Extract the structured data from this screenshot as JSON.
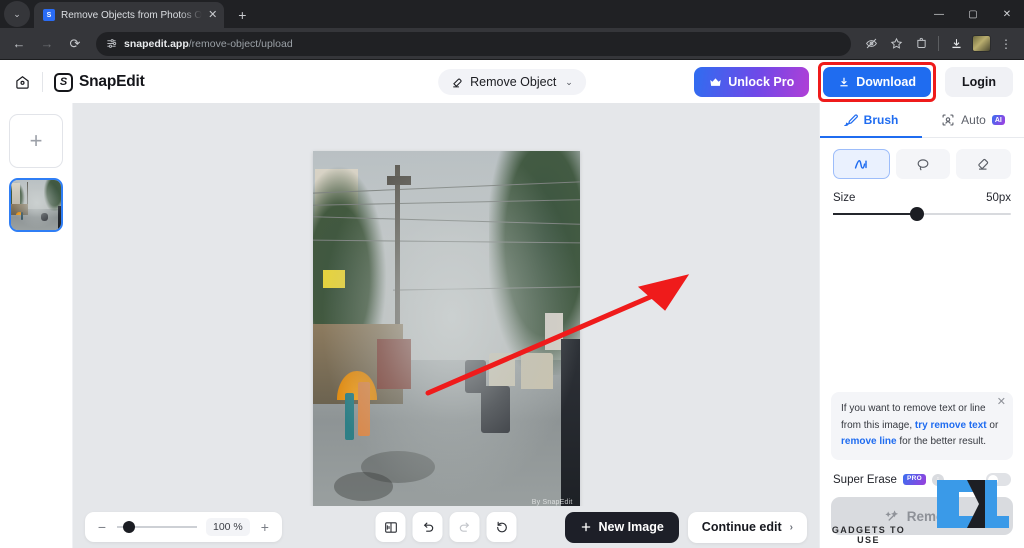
{
  "browser": {
    "tab": {
      "title": "Remove Objects from Photos O",
      "favicon": "S",
      "close_icon": "✕"
    },
    "new_tab_icon": "+",
    "tab_list_icon": "⌄",
    "window": {
      "minimize": "—",
      "maximize": "▢",
      "close": "✕"
    },
    "nav": {
      "back": "←",
      "forward": "→",
      "reload": "⟳"
    },
    "url": {
      "domain": "snapedit.app",
      "path": "/remove-object/upload",
      "site_icon": "site-settings"
    },
    "toolbar_icons": [
      "eye-slash-icon",
      "star-icon",
      "extensions-icon",
      "downloads-icon",
      "profile-avatar",
      "menu-icon"
    ]
  },
  "appbar": {
    "home_icon": "home",
    "brand_mark": "S",
    "brand_name": "SnapEdit",
    "mode": {
      "label": "Remove Object",
      "icon": "eraser-icon",
      "chevron": "⌄"
    },
    "unlock_pro": "Unlock Pro",
    "download": "Download",
    "login": "Login",
    "highlight_color": "#ef1b1b",
    "download_color": "#1f6cf0"
  },
  "sidebar": {
    "add_label": "+",
    "thumbnail_alt": "rainy street scene thumbnail"
  },
  "canvas": {
    "watermark": "By SnapEdit"
  },
  "panel": {
    "tabs": [
      {
        "label": "Brush",
        "icon": "brush-icon",
        "active": true
      },
      {
        "label": "Auto",
        "icon": "auto-select-icon",
        "badge": "AI",
        "active": false
      }
    ],
    "tools": [
      {
        "name": "brush-tool",
        "icon": "brush-stroke",
        "active": true
      },
      {
        "name": "lasso-tool",
        "icon": "lasso",
        "active": false
      },
      {
        "name": "eraser-tool",
        "icon": "eraser",
        "active": false
      }
    ],
    "size": {
      "label": "Size",
      "value": "50px",
      "percent": 50
    },
    "info": {
      "text_before": "If you want to remove text or line from this image, ",
      "link1": "try remove text",
      "between": " or ",
      "link2": "remove line",
      "text_after": " for the better result.",
      "close_icon": "✕"
    },
    "super_erase": {
      "label": "Super Erase",
      "badge": "PRO",
      "info_icon": "i",
      "enabled": false
    },
    "remove_button": {
      "label": "Remove",
      "icon": "magic-wand-icon",
      "disabled": true
    }
  },
  "watermark_overlay": {
    "text": "GADGETS TO USE"
  },
  "bottombar": {
    "zoom": {
      "minus": "−",
      "plus": "+",
      "value": "100 %",
      "percent": 18
    },
    "tools": [
      {
        "name": "compare-view",
        "icon": "compare",
        "dim": false
      },
      {
        "name": "undo",
        "icon": "↺",
        "dim": false
      },
      {
        "name": "redo",
        "icon": "↻",
        "dim": true
      },
      {
        "name": "reset",
        "icon": "⟲",
        "dim": false
      }
    ],
    "new_image": "New Image",
    "continue_edit": "Continue edit",
    "continue_chevron": "›"
  }
}
